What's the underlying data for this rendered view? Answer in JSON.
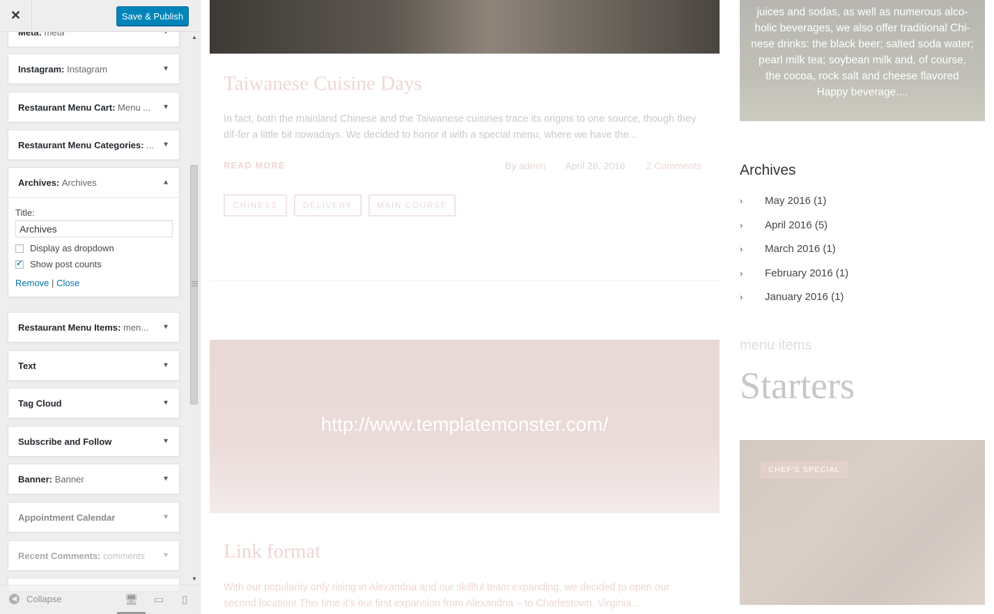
{
  "customizer": {
    "close_symbol": "✕",
    "publish_label": "Save & Publish",
    "widgets": [
      {
        "title": "Meta:",
        "subtitle": "meta"
      },
      {
        "title": "Instagram:",
        "subtitle": "Instagram"
      },
      {
        "title": "Restaurant Menu Cart:",
        "subtitle": "Menu ..."
      },
      {
        "title": "Restaurant Menu Categories:",
        "subtitle": "..."
      },
      {
        "title": "Archives:",
        "subtitle": "Archives"
      },
      {
        "title": "Restaurant Menu Items:",
        "subtitle": "men..."
      },
      {
        "title": "Text",
        "subtitle": ""
      },
      {
        "title": "Tag Cloud",
        "subtitle": ""
      },
      {
        "title": "Subscribe and Follow",
        "subtitle": ""
      },
      {
        "title": "Banner:",
        "subtitle": "Banner"
      },
      {
        "title": "Appointment Calendar",
        "subtitle": ""
      },
      {
        "title": "Recent Comments:",
        "subtitle": "comments"
      }
    ],
    "archives_form": {
      "title_label": "Title:",
      "title_value": "Archives",
      "display_dropdown_label": "Display as dropdown",
      "display_dropdown_checked": false,
      "show_counts_label": "Show post counts",
      "show_counts_checked": true,
      "remove_label": "Remove",
      "separator": "|",
      "close_label": "Close"
    },
    "footer": {
      "collapse_label": "Collapse",
      "devices": [
        "desktop-icon",
        "tablet-icon",
        "mobile-icon"
      ]
    },
    "accent_color": "#0085ba"
  },
  "preview": {
    "post": {
      "title": "Taiwanese Cuisine Days",
      "excerpt": "In fact, both the mainland Chinese and the Taiwanese cuisines trace its origins to one source, though they dif-fer a little bit nowadays. We decided to honor it with a special menu, where we have the...",
      "read_more": "READ MORE",
      "by_label": "By",
      "author": "admin",
      "date": "April 26, 2016",
      "comments": "2 Comments",
      "tags": [
        "CHINESS",
        "DELIVERY",
        "MAIN COURSE"
      ]
    },
    "link_post": {
      "url": "http://www.templatemonster.com/",
      "title": "Link format",
      "excerpt": "With our popularity only rising in Alexandria and our skillful team expanding, we decided to open our second location! This time it's our first expansion from Alexandria – to Charlestown, Virginia..."
    },
    "promo_text": "juices and sodas, as well as numerous alco-holic beverages, we also offer traditional Chi-nese drinks: the black beer; salted soda water; pearl milk tea; soybean milk and, of course, the cocoa, rock salt and cheese flavored Happy beverage....",
    "archives": {
      "heading": "Archives",
      "items": [
        {
          "label": "May 2016",
          "count": "(1)"
        },
        {
          "label": "April 2016",
          "count": "(5)"
        },
        {
          "label": "March 2016",
          "count": "(1)"
        },
        {
          "label": "February 2016",
          "count": "(1)"
        },
        {
          "label": "January 2016",
          "count": "(1)"
        }
      ]
    },
    "menu": {
      "label": "menu items",
      "heading": "Starters",
      "badge": "CHEF'S SPECIAL"
    },
    "accent_color": "#c97f76"
  }
}
